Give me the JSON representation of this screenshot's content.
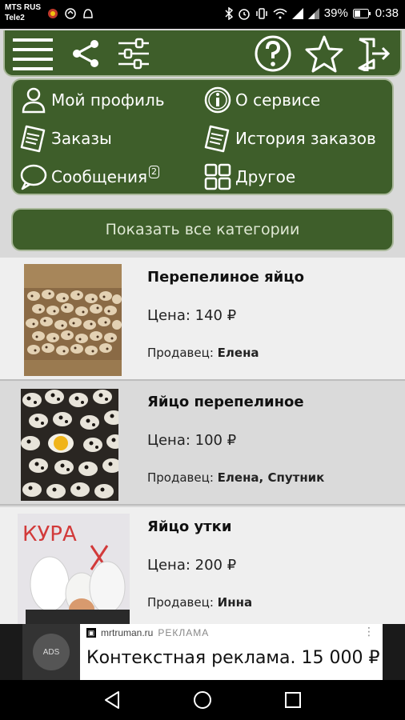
{
  "status_bar": {
    "carrier_1": "MTS RUS",
    "carrier_2": "Tele2",
    "battery": "39%",
    "time": "0:38"
  },
  "toolbar": {
    "icons": [
      "menu-icon",
      "share-icon",
      "filter-icon",
      "help-icon",
      "star-icon",
      "exit-icon"
    ]
  },
  "menu": {
    "profile": "Мой профиль",
    "about": "О сервисе",
    "orders": "Заказы",
    "history": "История заказов",
    "messages": "Сообщения",
    "messages_badge": "2",
    "other": "Другое"
  },
  "categories_button": "Показать все категории",
  "products": [
    {
      "title": "Перепелиное яйцо",
      "price": "Цена: 140 ₽",
      "seller_label": "Продавец: ",
      "seller": "Елена"
    },
    {
      "title": "Яйцо перепелиное",
      "price": "Цена: 100 ₽",
      "seller_label": "Продавец: ",
      "seller": "Елена,  Спутник"
    },
    {
      "title": "Яйцо утки",
      "price": "Цена: 200 ₽",
      "seller_label": "Продавец: ",
      "seller": "Инна"
    }
  ],
  "ad": {
    "badge": "ADS",
    "domain": "mrtruman.ru",
    "label": "РЕКЛАМА",
    "headline": "Контекстная реклама. 15 000 ₽"
  },
  "photo_text": "КУРА",
  "colors": {
    "accent_green": "#3e5e2a",
    "border": "#a9b89a"
  }
}
